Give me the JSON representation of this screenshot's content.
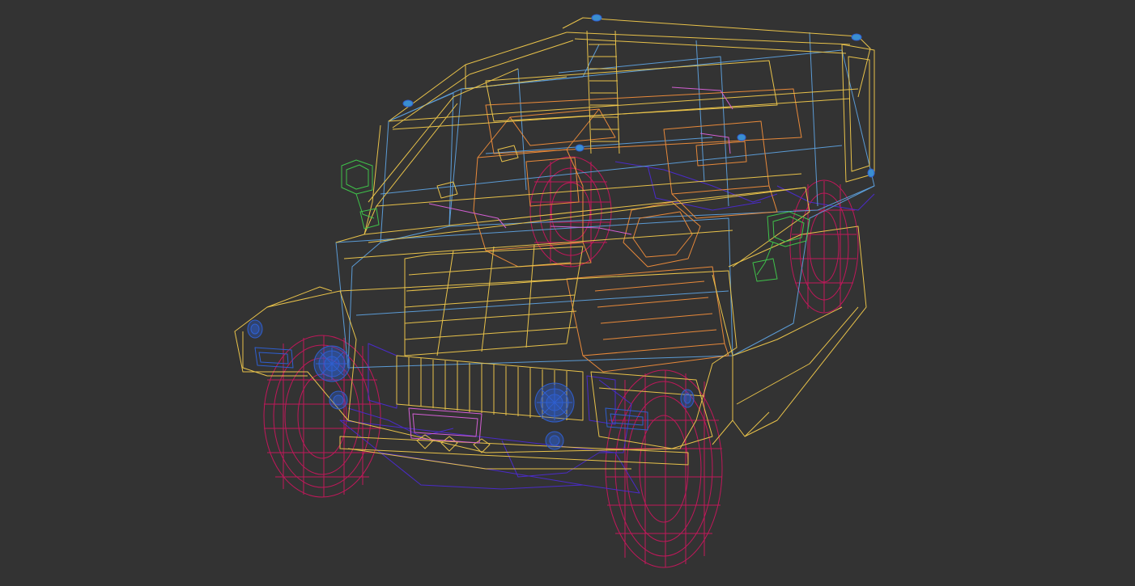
{
  "viewport": {
    "background": "#333333",
    "subject": "wireframe-vehicle-model"
  },
  "colors": {
    "body": "#e8c24a",
    "interior": "#e8893a",
    "glass": "#5b9bd5",
    "wheels": "#c0185a",
    "chassis": "#4a2bc9",
    "lights": "#2f5fd0",
    "mirrors": "#3fc24a",
    "accents": "#d35fd3",
    "marker": "#3a8fd0"
  }
}
